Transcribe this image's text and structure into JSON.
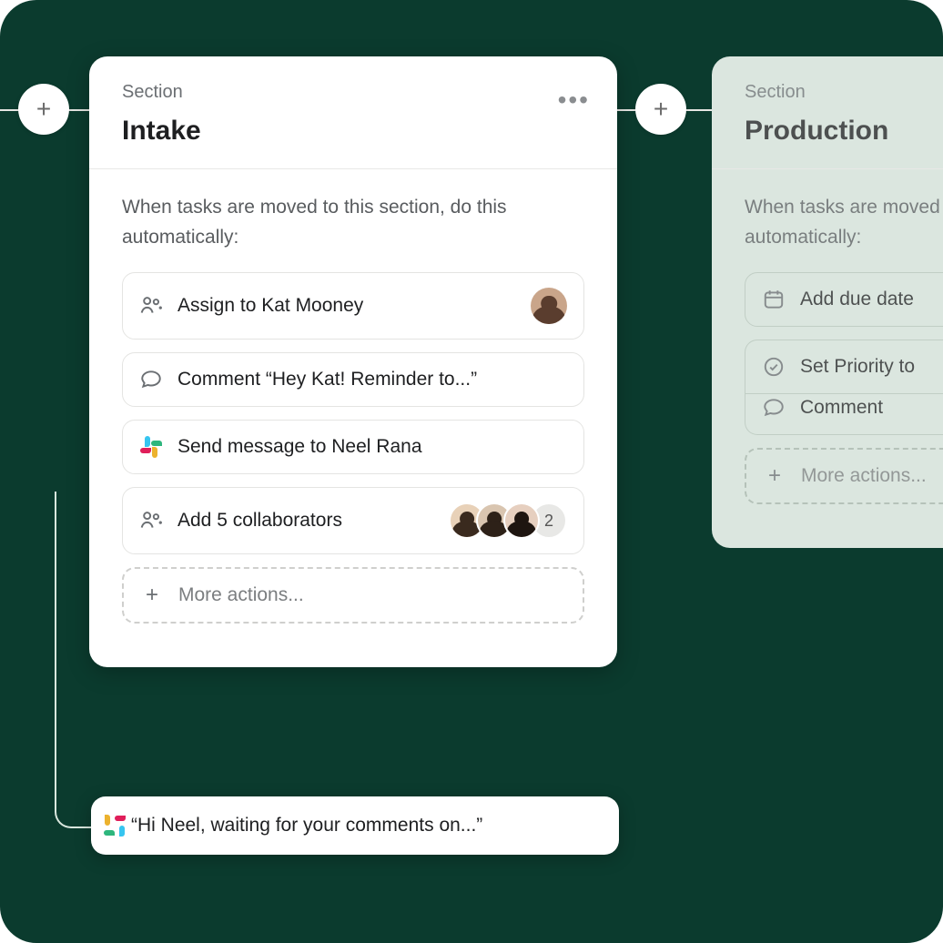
{
  "colors": {
    "bg": "#0b3b2e"
  },
  "connectors": {
    "add_glyph": "+"
  },
  "card1": {
    "section_label": "Section",
    "title": "Intake",
    "instruction": "When tasks are moved to this section, do this automatically:",
    "rules": {
      "assign": "Assign to Kat Mooney",
      "comment": "Comment “Hey Kat! Reminder to...”",
      "slack": "Send message to Neel Rana",
      "collab": "Add 5 collaborators",
      "collab_more_count": "2",
      "more": "More actions..."
    }
  },
  "card2": {
    "section_label": "Section",
    "title": "Production",
    "instruction": "When tasks are moved to this section, do this automatically:",
    "rules": {
      "due": "Add due date",
      "priority": "Set Priority to",
      "comment": "Comment",
      "more": "More actions..."
    }
  },
  "callout": {
    "text": "“Hi Neel, waiting for your comments on...”"
  }
}
